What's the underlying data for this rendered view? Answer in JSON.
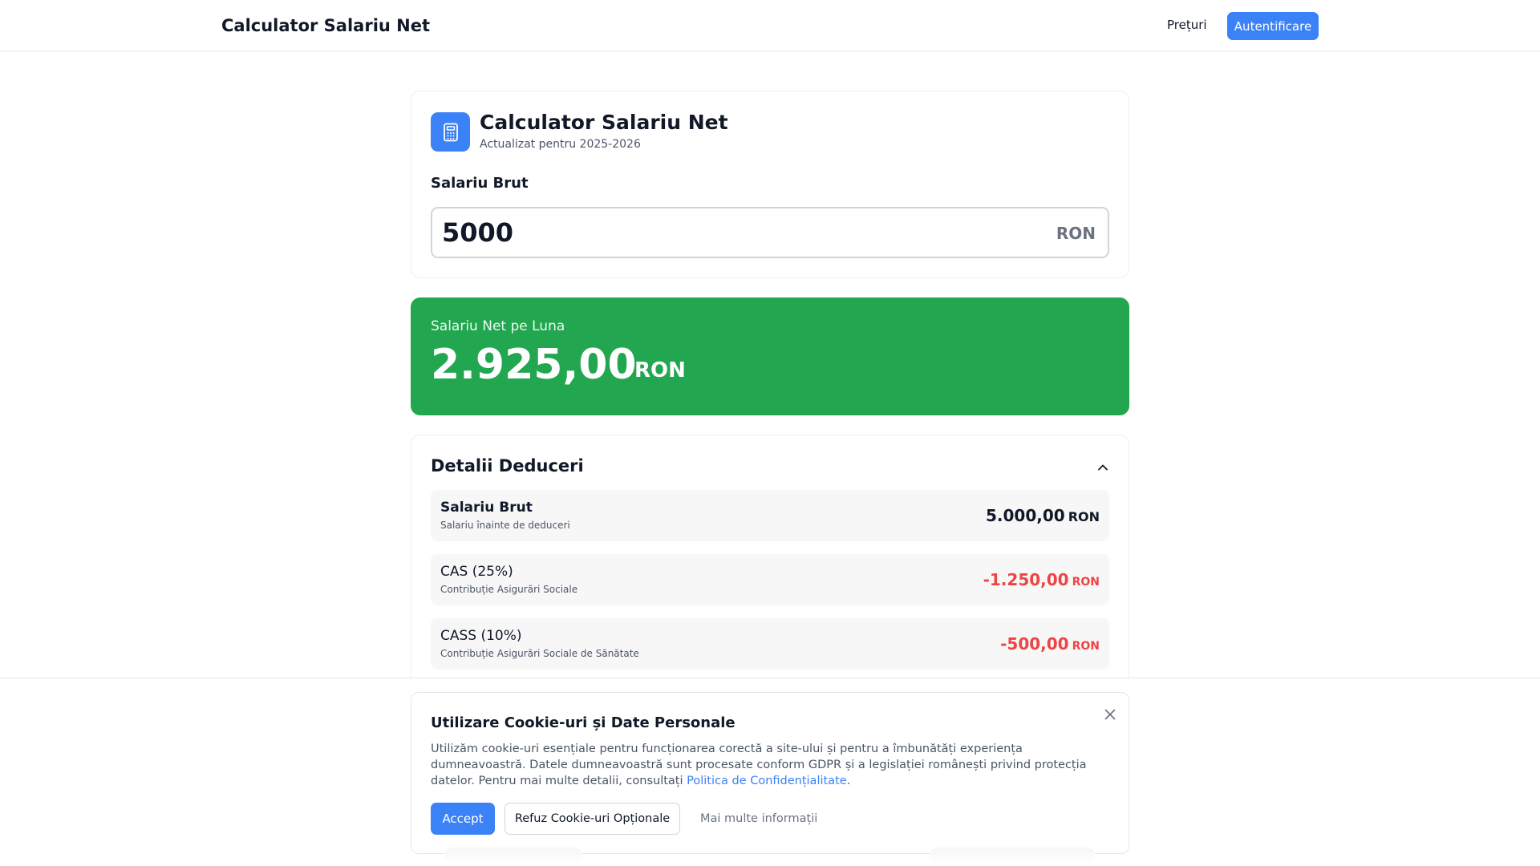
{
  "header": {
    "brand": "Calculator Salariu Net",
    "nav_pricing": "Prețuri",
    "login_button": "Autentificare"
  },
  "calculator": {
    "icon": "calculator-icon",
    "title": "Calculator Salariu Net",
    "subtitle": "Actualizat pentru 2025-2026",
    "gross_label": "Salariu Brut",
    "gross_value": "5000",
    "currency": "RON"
  },
  "net_result": {
    "label": "Salariu Net pe Luna",
    "value": "2.925,00",
    "currency": "RON"
  },
  "deductions": {
    "title": "Detalii Deduceri",
    "toggle_icon": "chevron-up-icon",
    "rows": [
      {
        "name": "Salariu Brut",
        "description": "Salariu înainte de deduceri",
        "amount": "5.000,00",
        "currency": "RON"
      },
      {
        "name": "CAS (25%)",
        "description": "Contribuție Asigurări Sociale",
        "amount": "-1.250,00",
        "currency": "RON"
      },
      {
        "name": "CASS (10%)",
        "description": "Contribuție Asigurări Sociale de Sănătate",
        "amount": "-500,00",
        "currency": "RON"
      }
    ]
  },
  "cookie_banner": {
    "title": "Utilizare Cookie-uri și Date Personale",
    "text": "Utilizăm cookie-uri esențiale pentru funcționarea corectă a site-ului și pentru a îmbunătăți experiența dumneavoastră. Datele dumneavoastră sunt procesate conform GDPR și a legislației românești privind protecția datelor. Pentru mai multe detalii, consultați ",
    "link": "Politica de Confidențialitate",
    "text_end": ".",
    "accept": "Accept",
    "refuse": "Refuz Cookie-uri Opționale",
    "more_info": "Mai multe informații",
    "close_icon": "close-icon"
  },
  "colors": {
    "primary": "#3b82f6",
    "success": "#22a64f",
    "negative": "#ef4444"
  }
}
